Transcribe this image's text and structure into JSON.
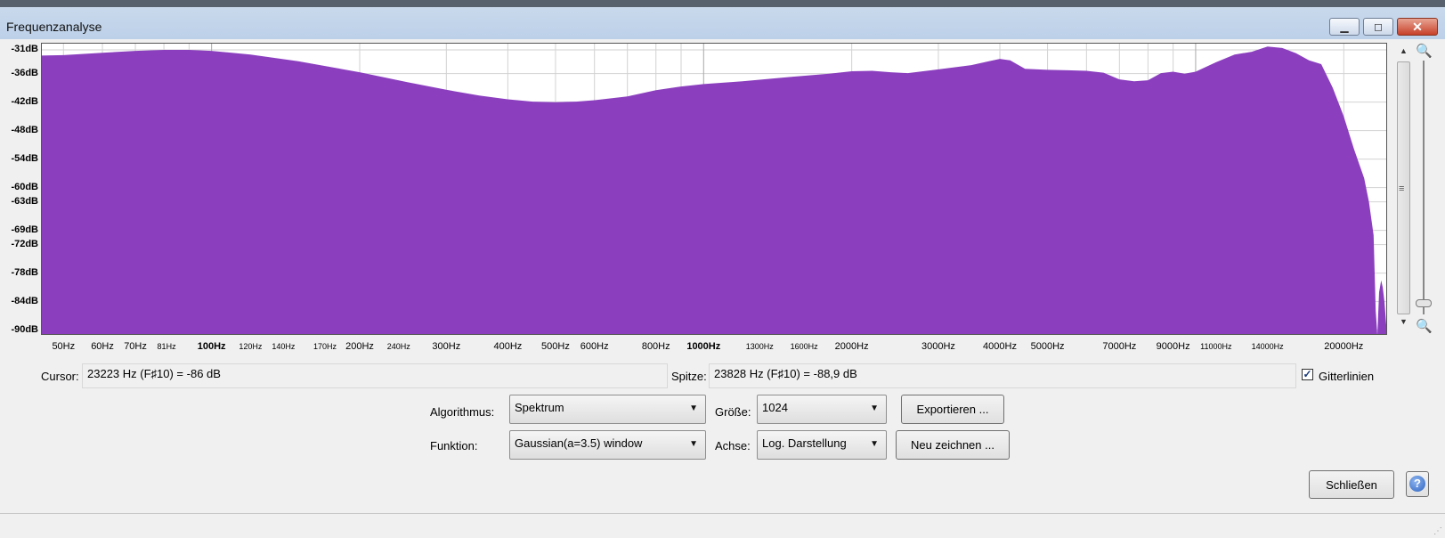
{
  "window": {
    "title": "Frequenzanalyse",
    "minimize_glyph": "▁",
    "maximize_glyph": "◻",
    "close_glyph": "✕"
  },
  "colors": {
    "spectrum_fill": "#8b3fbf",
    "plot_background": "#ffffff",
    "grid": "#d2d2d2"
  },
  "chart_data": {
    "type": "area",
    "x_scale": "log",
    "xlim": [
      45,
      24500
    ],
    "ylim": [
      -91,
      -29.5
    ],
    "y_ticks": [
      "-31dB",
      "-36dB",
      "-42dB",
      "-48dB",
      "-54dB",
      "-60dB",
      "-63dB",
      "-69dB",
      "-72dB",
      "-78dB",
      "-84dB",
      "-90dB"
    ],
    "y_tick_values": [
      -31,
      -36,
      -42,
      -48,
      -54,
      -60,
      -63,
      -69,
      -72,
      -78,
      -84,
      -90
    ],
    "x_ticks": [
      {
        "label": "50Hz",
        "value": 50,
        "style": "m"
      },
      {
        "label": "60Hz",
        "value": 60,
        "style": "m"
      },
      {
        "label": "70Hz",
        "value": 70,
        "style": "m"
      },
      {
        "label": "81Hz",
        "value": 81,
        "style": "s"
      },
      {
        "label": "100Hz",
        "value": 100,
        "style": "b"
      },
      {
        "label": "120Hz",
        "value": 120,
        "style": "s"
      },
      {
        "label": "140Hz",
        "value": 140,
        "style": "s"
      },
      {
        "label": "170Hz",
        "value": 170,
        "style": "s"
      },
      {
        "label": "200Hz",
        "value": 200,
        "style": "m"
      },
      {
        "label": "240Hz",
        "value": 240,
        "style": "s"
      },
      {
        "label": "300Hz",
        "value": 300,
        "style": "m"
      },
      {
        "label": "400Hz",
        "value": 400,
        "style": "m"
      },
      {
        "label": "500Hz",
        "value": 500,
        "style": "m"
      },
      {
        "label": "600Hz",
        "value": 600,
        "style": "m"
      },
      {
        "label": "800Hz",
        "value": 800,
        "style": "m"
      },
      {
        "label": "1000Hz",
        "value": 1000,
        "style": "b"
      },
      {
        "label": "1300Hz",
        "value": 1300,
        "style": "s"
      },
      {
        "label": "1600Hz",
        "value": 1600,
        "style": "s"
      },
      {
        "label": "2000Hz",
        "value": 2000,
        "style": "m"
      },
      {
        "label": "3000Hz",
        "value": 3000,
        "style": "m"
      },
      {
        "label": "4000Hz",
        "value": 4000,
        "style": "m"
      },
      {
        "label": "5000Hz",
        "value": 5000,
        "style": "m"
      },
      {
        "label": "7000Hz",
        "value": 7000,
        "style": "m"
      },
      {
        "label": "9000Hz",
        "value": 9000,
        "style": "m"
      },
      {
        "label": "11000Hz",
        "value": 11000,
        "style": "s"
      },
      {
        "label": "14000Hz",
        "value": 14000,
        "style": "s"
      },
      {
        "label": "20000Hz",
        "value": 20000,
        "style": "m"
      }
    ],
    "series": [
      {
        "x": [
          45,
          50,
          60,
          70,
          80,
          90,
          100,
          120,
          150,
          200,
          250,
          300,
          350,
          400,
          450,
          500,
          550,
          600,
          700,
          800,
          900,
          1000,
          1200,
          1500,
          1800,
          2000,
          2200,
          2400,
          2600,
          3000,
          3500,
          3800,
          4000,
          4200,
          4500,
          5000,
          5500,
          6000,
          6500,
          7000,
          7500,
          8000,
          8500,
          9000,
          9500,
          10000,
          11000,
          12000,
          13000,
          14000,
          15000,
          16000,
          17000,
          18000,
          19000,
          20000,
          21000,
          22000,
          22500,
          23000,
          23223,
          23400,
          23600,
          23828,
          24000,
          24200,
          24400,
          24500
        ],
        "y": [
          -32.2,
          -32.1,
          -31.6,
          -31.2,
          -31.0,
          -31.0,
          -31.2,
          -32.0,
          -33.4,
          -35.7,
          -37.8,
          -39.4,
          -40.6,
          -41.4,
          -41.9,
          -42.0,
          -41.9,
          -41.6,
          -40.8,
          -39.5,
          -38.7,
          -38.2,
          -37.6,
          -36.7,
          -36.0,
          -35.5,
          -35.4,
          -35.7,
          -35.9,
          -35.1,
          -34.2,
          -33.4,
          -32.9,
          -33.2,
          -35.0,
          -35.2,
          -35.3,
          -35.4,
          -35.8,
          -37.2,
          -37.6,
          -37.4,
          -35.9,
          -35.6,
          -36.0,
          -35.6,
          -33.6,
          -32.0,
          -31.4,
          -30.3,
          -30.6,
          -31.7,
          -33.2,
          -34.0,
          -39.0,
          -45.0,
          -52.0,
          -58.0,
          -63.0,
          -70.0,
          -86.0,
          -91.0,
          -82.0,
          -79.5,
          -81.0,
          -84.0,
          -88.9,
          -91.0
        ]
      }
    ]
  },
  "cursor": {
    "label": "Cursor:",
    "value": "23223 Hz (F♯10) = -86 dB"
  },
  "peak": {
    "label": "Spitze:",
    "value": "23828 Hz (F♯10) = -88,9 dB"
  },
  "grid": {
    "label": "Gitterlinien",
    "checked": true,
    "check_glyph": "✓"
  },
  "algorithm": {
    "label": "Algorithmus:",
    "value": "Spektrum"
  },
  "size": {
    "label": "Größe:",
    "value": "1024"
  },
  "function": {
    "label": "Funktion:",
    "value": "Gaussian(a=3.5) window"
  },
  "axis": {
    "label": "Achse:",
    "value": "Log. Darstellung"
  },
  "buttons": {
    "export": "Exportieren ...",
    "redraw": "Neu zeichnen ...",
    "close": "Schließen",
    "help": "?"
  },
  "icons": {
    "dropdown": "▼",
    "scroll_up": "▲",
    "scroll_down": "▼",
    "grip": "≡",
    "zoom_in": "🔍",
    "zoom_out": "🔍",
    "size_grip": "⋰"
  }
}
